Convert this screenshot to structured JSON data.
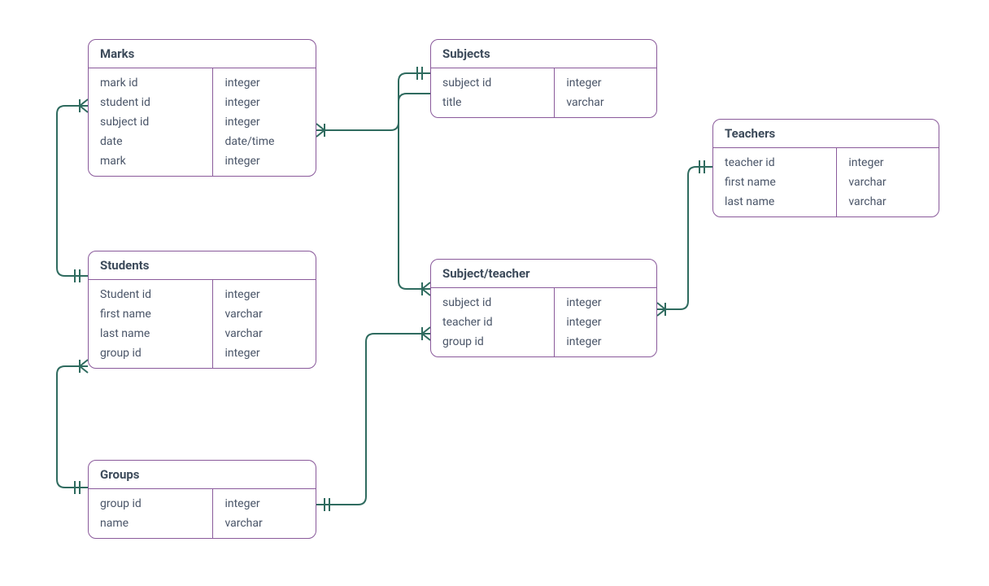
{
  "diagram_type": "entity-relationship",
  "colors": {
    "border": "#8a5a9b",
    "text": "#3c4a5a",
    "connector": "#2f6b5f"
  },
  "entities": {
    "marks": {
      "title": "Marks",
      "rows": [
        {
          "name": "mark id",
          "type": "integer"
        },
        {
          "name": "student id",
          "type": "integer"
        },
        {
          "name": "subject id",
          "type": "integer"
        },
        {
          "name": "date",
          "type": "date/time"
        },
        {
          "name": "mark",
          "type": "integer"
        }
      ]
    },
    "subjects": {
      "title": "Subjects",
      "rows": [
        {
          "name": "subject id",
          "type": "integer"
        },
        {
          "name": "title",
          "type": "varchar"
        }
      ]
    },
    "teachers": {
      "title": "Teachers",
      "rows": [
        {
          "name": "teacher id",
          "type": "integer"
        },
        {
          "name": "first name",
          "type": "varchar"
        },
        {
          "name": "last name",
          "type": "varchar"
        }
      ]
    },
    "students": {
      "title": "Students",
      "rows": [
        {
          "name": "Student id",
          "type": "integer"
        },
        {
          "name": "first name",
          "type": "varchar"
        },
        {
          "name": "last name",
          "type": "varchar"
        },
        {
          "name": "group id",
          "type": "integer"
        }
      ]
    },
    "subject_teacher": {
      "title": "Subject/teacher",
      "rows": [
        {
          "name": "subject id",
          "type": "integer"
        },
        {
          "name": "teacher id",
          "type": "integer"
        },
        {
          "name": "group id",
          "type": "integer"
        }
      ]
    },
    "groups": {
      "title": "Groups",
      "rows": [
        {
          "name": "group id",
          "type": "integer"
        },
        {
          "name": "name",
          "type": "varchar"
        }
      ]
    }
  },
  "relationships": [
    {
      "from": "students",
      "to": "marks",
      "cardinality": "one-to-many"
    },
    {
      "from": "groups",
      "to": "students",
      "cardinality": "one-to-many"
    },
    {
      "from": "subjects",
      "to": "marks",
      "cardinality": "one-to-many"
    },
    {
      "from": "subjects",
      "to": "subject_teacher",
      "cardinality": "one-to-many"
    },
    {
      "from": "teachers",
      "to": "subject_teacher",
      "cardinality": "one-to-many"
    },
    {
      "from": "groups",
      "to": "subject_teacher",
      "cardinality": "one-to-many"
    }
  ]
}
